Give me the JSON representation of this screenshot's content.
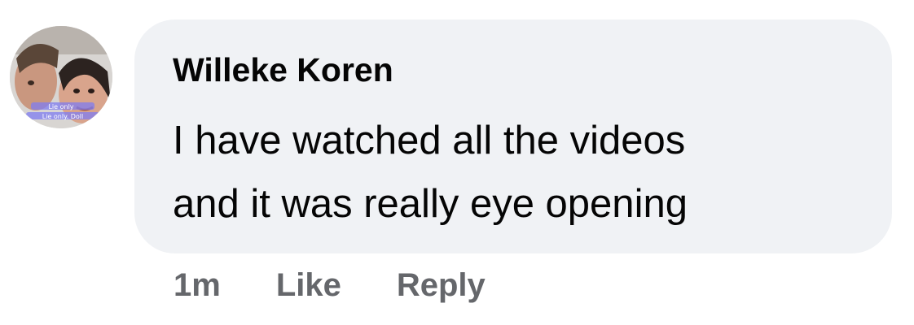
{
  "comment": {
    "author": "Willeke Koren",
    "text_lines": [
      "I have watched all the videos",
      "and it was really eye opening"
    ],
    "timestamp": "1m",
    "like_label": "Like",
    "reply_label": "Reply"
  },
  "avatar": {
    "overlay_text_1": "Lie only",
    "overlay_text_2": "Lie only. Doll"
  },
  "colors": {
    "bubble_bg": "#f0f2f5",
    "text_primary": "#050505",
    "text_secondary": "#65676b"
  }
}
